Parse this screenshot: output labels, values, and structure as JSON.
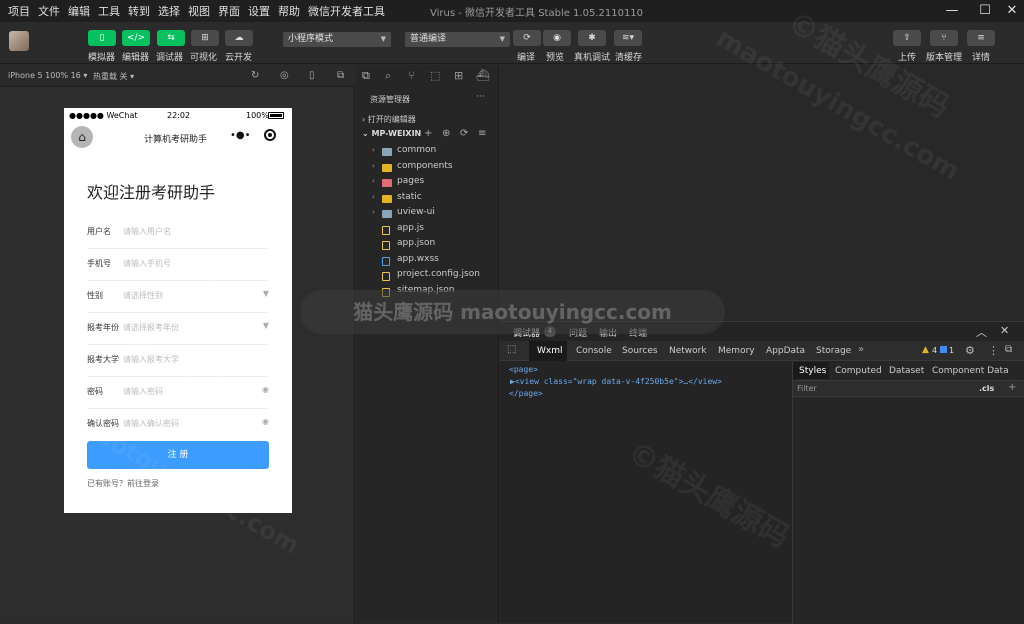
{
  "menu": [
    "项目",
    "文件",
    "编辑",
    "工具",
    "转到",
    "选择",
    "视图",
    "界面",
    "设置",
    "帮助",
    "微信开发者工具"
  ],
  "window_title": "Virus - 微信开发者工具 Stable 1.05.2110110",
  "toolbar": {
    "simulator": "模拟器",
    "editor": "编辑器",
    "debugger": "调试器",
    "visualize": "可视化",
    "cloud": "云开发",
    "mode_select": "小程序模式",
    "compile_select": "普通编译",
    "compile": "编译",
    "preview": "预览",
    "real_debug": "真机调试",
    "clear_cache": "清缓存",
    "upload": "上传",
    "version": "版本管理",
    "details": "详情"
  },
  "simbar": {
    "device": "iPhone 5 100% 16",
    "hotreload": "热重载 关"
  },
  "phone": {
    "status_carrier": "●●●●● WeChat",
    "status_time": "22:02",
    "status_battery": "100%",
    "nav_title": "计算机考研助手",
    "heading": "欢迎注册考研助手",
    "fields": [
      {
        "label": "用户名",
        "placeholder": "请输入用户名",
        "arrow": ""
      },
      {
        "label": "手机号",
        "placeholder": "请输入手机号",
        "arrow": ""
      },
      {
        "label": "性别",
        "placeholder": "请选择性别",
        "arrow": "▼"
      },
      {
        "label": "报考年份",
        "placeholder": "请选择报考年份",
        "arrow": "▼"
      },
      {
        "label": "报考大学",
        "placeholder": "请输入报考大学",
        "arrow": ""
      },
      {
        "label": "密码",
        "placeholder": "请输入密码",
        "arrow": "◉"
      },
      {
        "label": "确认密码",
        "placeholder": "请输入确认密码",
        "arrow": "◉"
      }
    ],
    "register": "注 册",
    "login_link": "已有账号？前往登录"
  },
  "explorer": {
    "header": "资源管理器",
    "open_editors": "打开的编辑器",
    "project": "MP-WEIXIN",
    "items": [
      {
        "name": "common",
        "kind": "folder",
        "color": "#8aa4b8"
      },
      {
        "name": "components",
        "kind": "folder",
        "color": "#e6b422"
      },
      {
        "name": "pages",
        "kind": "folder",
        "color": "#e06c75"
      },
      {
        "name": "static",
        "kind": "folder",
        "color": "#e6b422"
      },
      {
        "name": "uview-ui",
        "kind": "folder",
        "color": "#8aa4b8"
      },
      {
        "name": "app.js",
        "kind": "file",
        "color": "#e6c84a"
      },
      {
        "name": "app.json",
        "kind": "file",
        "color": "#e6c84a"
      },
      {
        "name": "app.wxss",
        "kind": "file",
        "color": "#4f9fe6"
      },
      {
        "name": "project.config.json",
        "kind": "file",
        "color": "#e6c84a"
      },
      {
        "name": "sitemap.json",
        "kind": "file",
        "color": "#e6c84a"
      }
    ]
  },
  "debugger": {
    "tabs_top": [
      "调试器",
      "问题",
      "输出",
      "终端"
    ],
    "badge": "4",
    "tabs": [
      "Wxml",
      "Console",
      "Sources",
      "Network",
      "Memory",
      "AppData",
      "Storage"
    ],
    "warn_count": "4",
    "info_count": "1",
    "code": [
      "<page>",
      "▶<view class=\"wrap data-v-4f250b5e\">…</view>",
      "</page>"
    ],
    "side_tabs": [
      "Styles",
      "Computed",
      "Dataset",
      "Component Data"
    ],
    "filter": "Filter",
    "cls": ".cls"
  },
  "watermark": {
    "cn": "猫头鹰源码",
    "url": "maotouyingcc.com",
    "combined": "猫头鹰源码 maotouyingcc.com",
    "copy": "©猫头鹰源码"
  }
}
